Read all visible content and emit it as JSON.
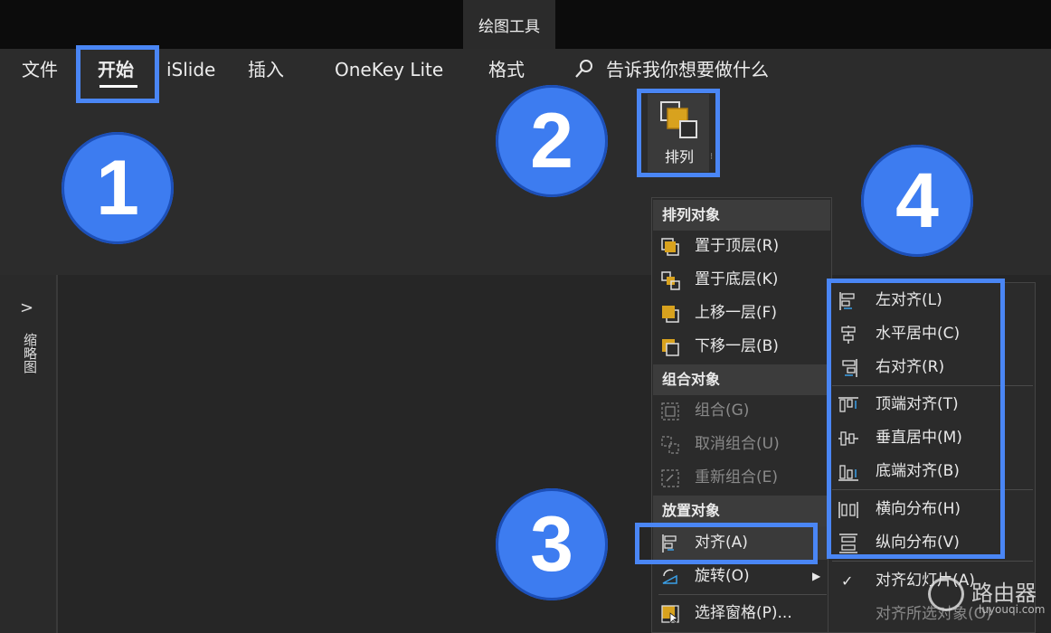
{
  "window": {
    "contextual_tab": "绘图工具"
  },
  "ribbon_tabs": [
    "文件",
    "开始",
    "iSlide",
    "插入",
    "OneKey Lite",
    "格式"
  ],
  "tell_me": {
    "placeholder": "告诉我你想要做什么"
  },
  "arrange_button": {
    "label": "排列"
  },
  "steps": [
    "1",
    "2",
    "3",
    "4"
  ],
  "thumbnail_pane": {
    "label": "缩略图"
  },
  "arrange_menu": {
    "sections": [
      {
        "header": "排列对象",
        "items": [
          {
            "label": "置于顶层(R)",
            "icon": "bring-to-front-icon",
            "enabled": true
          },
          {
            "label": "置于底层(K)",
            "icon": "send-to-back-icon",
            "enabled": true
          },
          {
            "label": "上移一层(F)",
            "icon": "bring-forward-icon",
            "enabled": true
          },
          {
            "label": "下移一层(B)",
            "icon": "send-backward-icon",
            "enabled": true
          }
        ]
      },
      {
        "header": "组合对象",
        "items": [
          {
            "label": "组合(G)",
            "icon": "group-icon",
            "enabled": false
          },
          {
            "label": "取消组合(U)",
            "icon": "ungroup-icon",
            "enabled": false
          },
          {
            "label": "重新组合(E)",
            "icon": "regroup-icon",
            "enabled": false
          }
        ]
      },
      {
        "header": "放置对象",
        "items": [
          {
            "label": "对齐(A)",
            "icon": "align-icon",
            "enabled": true
          },
          {
            "label": "旋转(O)",
            "icon": "rotate-icon",
            "enabled": true
          },
          {
            "label": "选择窗格(P)...",
            "icon": "selection-pane-icon",
            "enabled": true
          }
        ]
      }
    ]
  },
  "align_submenu": {
    "items": [
      {
        "label": "左对齐(L)",
        "icon": "align-left-icon"
      },
      {
        "label": "水平居中(C)",
        "icon": "align-center-icon"
      },
      {
        "label": "右对齐(R)",
        "icon": "align-right-icon"
      },
      {
        "label": "顶端对齐(T)",
        "icon": "align-top-icon"
      },
      {
        "label": "垂直居中(M)",
        "icon": "align-middle-icon"
      },
      {
        "label": "底端对齐(B)",
        "icon": "align-bottom-icon"
      },
      {
        "label": "横向分布(H)",
        "icon": "distribute-horizontal-icon"
      },
      {
        "label": "纵向分布(V)",
        "icon": "distribute-vertical-icon"
      },
      {
        "label": "对齐幻灯片(A)",
        "icon": "check-icon",
        "checked": true
      },
      {
        "label": "对齐所选对象(O)",
        "icon": "",
        "enabled": false
      }
    ]
  },
  "watermark": {
    "text": "路由器",
    "url": "luyouqi.com"
  },
  "colors": {
    "highlight": "#4a86f5",
    "step_circle": "#3d7cf0",
    "icon_orange": "#d8a21e"
  }
}
